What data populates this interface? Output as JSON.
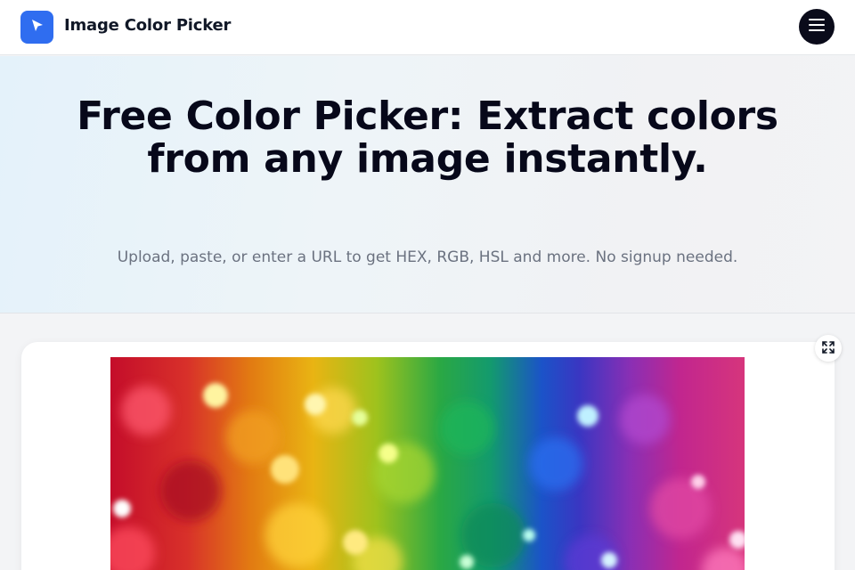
{
  "header": {
    "brand": "Image Color Picker",
    "logo_icon": "cursor-arrow-icon",
    "menu_icon": "hamburger-menu-icon",
    "brand_color": "#2f6df0"
  },
  "hero": {
    "title": "Free Color Picker: Extract colors from any image instantly.",
    "subtitle": "Upload, paste, or enter a URL to get HEX, RGB, HSL and more. No signup needed."
  },
  "workspace": {
    "expand_icon": "expand-icon",
    "image_description_colors": [
      "#c40d2a",
      "#e9b413",
      "#2aa844",
      "#1b53c8",
      "#c2268e"
    ]
  }
}
